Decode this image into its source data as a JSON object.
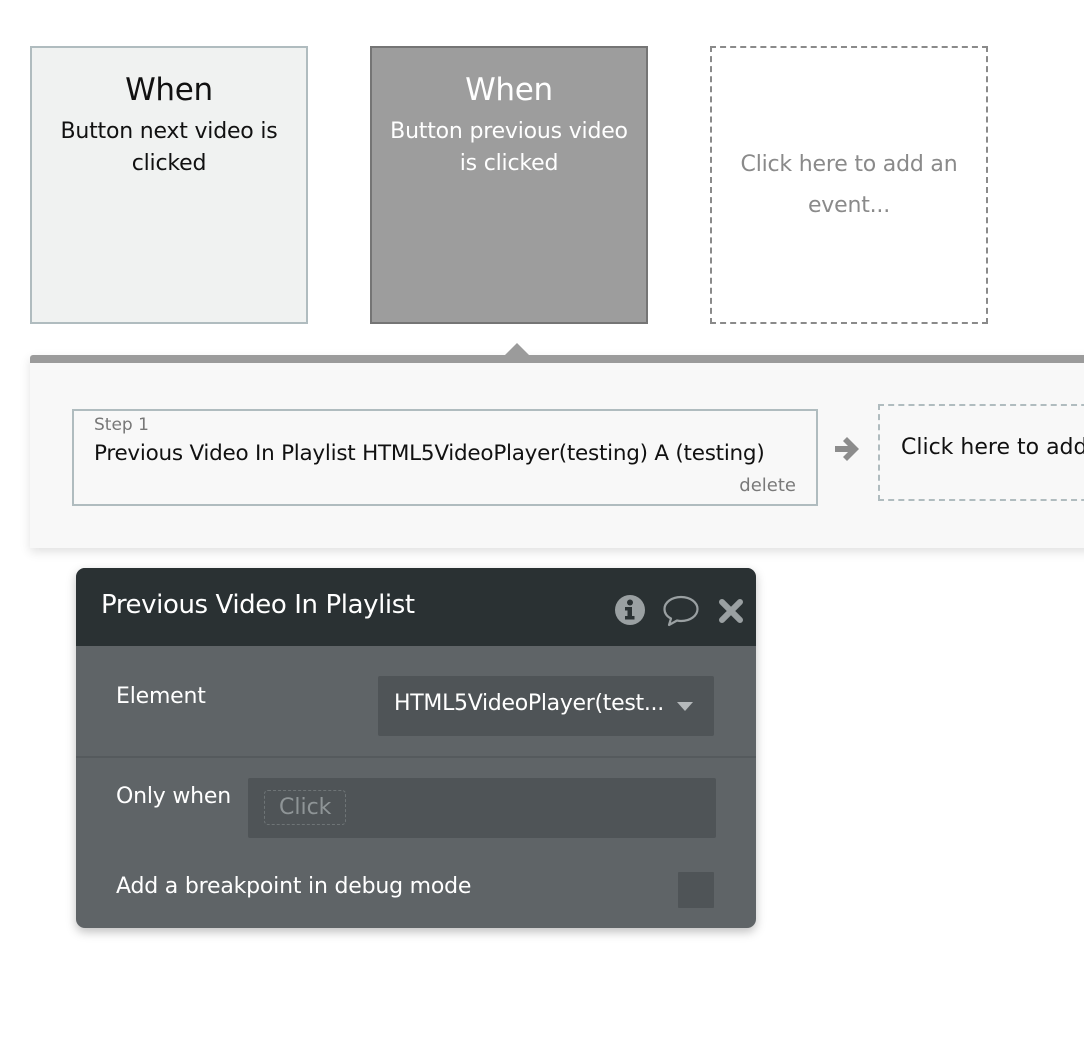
{
  "events": [
    {
      "heading": "When",
      "description": "Button next video is clicked",
      "selected": false
    },
    {
      "heading": "When",
      "description": "Button previous video is clicked",
      "selected": true
    }
  ],
  "add_event": {
    "label": "Click here to add an event..."
  },
  "workflow": {
    "steps": [
      {
        "label": "Step 1",
        "title": "Previous Video In Playlist HTML5VideoPlayer(testing) A (testing)",
        "delete_label": "delete"
      }
    ],
    "add_action_label": "Click here to add an action..."
  },
  "property_editor": {
    "title": "Previous Video In Playlist",
    "icons": [
      "info-icon",
      "comment-icon",
      "close-icon"
    ],
    "fields": {
      "element": {
        "label": "Element",
        "value": "HTML5VideoPlayer(test..."
      },
      "only_when": {
        "label": "Only when",
        "placeholder": "Click"
      },
      "breakpoint": {
        "label": "Add a breakpoint in debug mode",
        "checked": false
      }
    }
  },
  "colors": {
    "selected_event_bg": "#9d9d9d",
    "editor_header_bg": "#2a3133",
    "editor_body_bg": "#5f6467"
  }
}
